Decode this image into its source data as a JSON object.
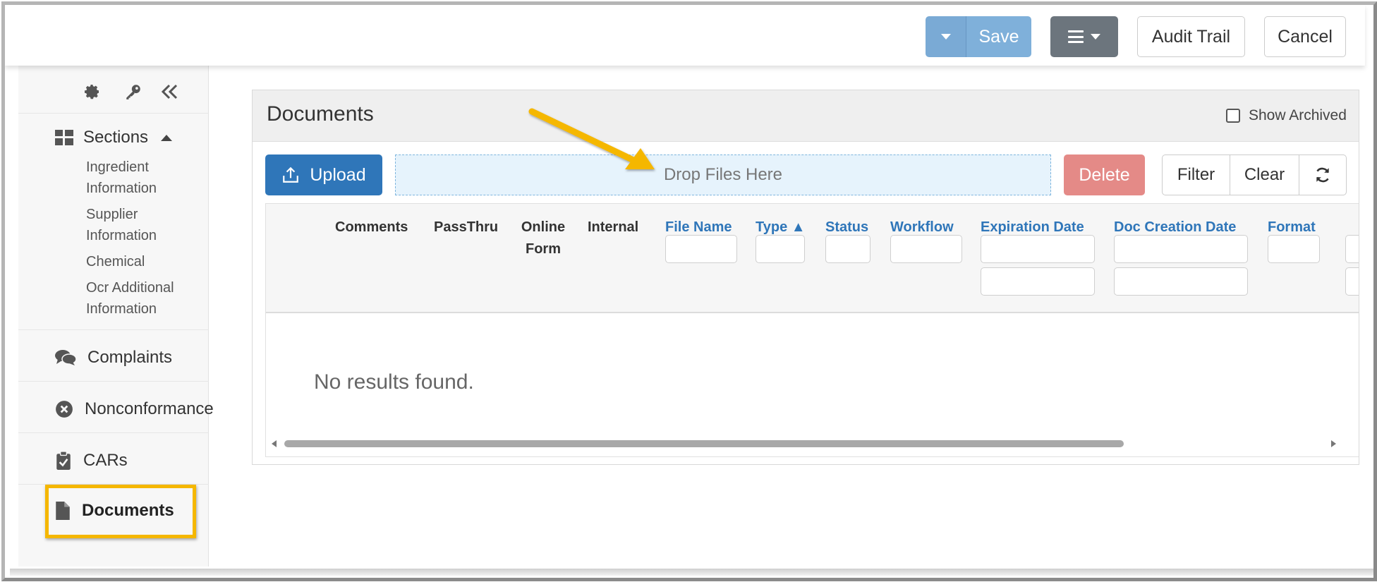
{
  "toolbar": {
    "save_label": "Save",
    "audit_trail_label": "Audit Trail",
    "cancel_label": "Cancel",
    "primary_color": "#7fb0da",
    "menu_color": "#6c757d"
  },
  "sidebar": {
    "tools": [
      "gear-icon",
      "key-icon",
      "collapse-icon"
    ],
    "sections_label": "Sections",
    "sub_items": [
      {
        "label": "Ingredient Information"
      },
      {
        "label": "Supplier Information"
      },
      {
        "label": "Chemical"
      },
      {
        "label": "Ocr Additional Information"
      }
    ],
    "items": [
      {
        "label": "Complaints",
        "icon": "comments-icon"
      },
      {
        "label": "Nonconformance",
        "icon": "times-circle-icon"
      },
      {
        "label": "CARs",
        "icon": "clipboard-check-icon"
      },
      {
        "label": "Documents",
        "icon": "file-icon",
        "active": true
      }
    ],
    "highlight_color": "#f5b700"
  },
  "panel": {
    "title": "Documents",
    "show_archived_label": "Show Archived",
    "upload_label": "Upload",
    "dropzone_label": "Drop Files Here",
    "delete_label": "Delete",
    "filter_label": "Filter",
    "clear_label": "Clear",
    "delete_color": "#e48a87",
    "upload_color": "#2f76b9"
  },
  "grid": {
    "columns": [
      {
        "label": "Comments"
      },
      {
        "label": "PassThru"
      },
      {
        "label": "Online Form"
      },
      {
        "label": "Internal"
      },
      {
        "label": "File Name"
      },
      {
        "label": "Type ▲"
      },
      {
        "label": "Status"
      },
      {
        "label": "Workflow"
      },
      {
        "label": "Expiration Date"
      },
      {
        "label": "Doc Creation Date"
      },
      {
        "label": "Format"
      }
    ],
    "empty_message": "No results found."
  }
}
